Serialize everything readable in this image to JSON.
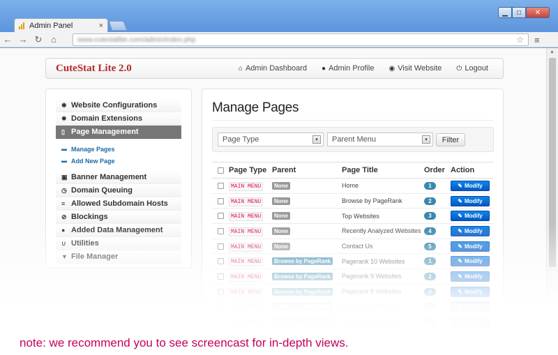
{
  "browser": {
    "tab_title": "Admin Panel",
    "tab_close": "×",
    "url": "www.cutestatlite.com/admin/index.php",
    "controls": {
      "minimize": "▁",
      "maximize": "□",
      "close": "✕"
    },
    "nav": {
      "back": "←",
      "forward": "→",
      "reload": "↻",
      "home": "⌂",
      "star": "☆",
      "menu": "≡"
    }
  },
  "navbar": {
    "brand": "CuteStat Lite 2.0",
    "links": [
      {
        "label": "Admin Dashboard",
        "icon": "home-icon",
        "glyph": "⌂"
      },
      {
        "label": "Admin Profile",
        "icon": "user-icon",
        "glyph": "●"
      },
      {
        "label": "Visit Website",
        "icon": "globe-icon",
        "glyph": "◉"
      },
      {
        "label": "Logout",
        "icon": "power-icon",
        "glyph": "⏻"
      }
    ]
  },
  "sidebar": {
    "items": [
      {
        "label": "Website Configurations",
        "icon": "gear-icon",
        "glyph": "✱"
      },
      {
        "label": "Domain Extensions",
        "icon": "asterisk-icon",
        "glyph": "✸"
      },
      {
        "label": "Page Management",
        "icon": "file-icon",
        "glyph": "▯"
      },
      {
        "label": "Banner Management",
        "icon": "picture-icon",
        "glyph": "▣"
      },
      {
        "label": "Domain Queuing",
        "icon": "time-icon",
        "glyph": "◷"
      },
      {
        "label": "Allowed Subdomain Hosts",
        "icon": "tasks-icon",
        "glyph": "≡"
      },
      {
        "label": "Blockings",
        "icon": "ban-icon",
        "glyph": "⊘"
      },
      {
        "label": "Added Data Management",
        "icon": "map-marker-icon",
        "glyph": "●"
      },
      {
        "label": "Utilities",
        "icon": "magnet-icon",
        "glyph": "∪"
      },
      {
        "label": "File Manager",
        "icon": "filter-icon",
        "glyph": "▼"
      }
    ],
    "sub_items": [
      {
        "label": "Manage Pages",
        "icon": "minus-icon",
        "glyph": "▬"
      },
      {
        "label": "Add New Page",
        "icon": "minus-icon",
        "glyph": "▬"
      }
    ]
  },
  "main": {
    "title": "Manage Pages",
    "filter": {
      "page_type": "Page Type",
      "parent_menu": "Parent Menu",
      "button": "Filter",
      "arrow": "▾"
    },
    "table": {
      "headers": [
        "Page Type",
        "Parent",
        "Page Title",
        "Order",
        "Action"
      ],
      "rows": [
        {
          "type": "MAIN MENU",
          "parent": "None",
          "title": "Home",
          "order": "1",
          "action": "Modify"
        },
        {
          "type": "MAIN MENU",
          "parent": "None",
          "title": "Browse by PageRank",
          "order": "2",
          "action": "Modify"
        },
        {
          "type": "MAIN MENU",
          "parent": "None",
          "title": "Top Websites",
          "order": "3",
          "action": "Modify"
        },
        {
          "type": "MAIN MENU",
          "parent": "None",
          "title": "Recently Analyzed Websites",
          "order": "4",
          "action": "Modify"
        },
        {
          "type": "MAIN MENU",
          "parent": "None",
          "title": "Contact Us",
          "order": "5",
          "action": "Modify"
        },
        {
          "type": "MAIN MENU",
          "parent": "Browse by PageRank",
          "title": "Pagerank 10 Websites",
          "order": "1",
          "action": "Modify"
        },
        {
          "type": "MAIN MENU",
          "parent": "Browse by PageRank",
          "title": "Pagerank 9 Websites",
          "order": "2",
          "action": "Modify"
        },
        {
          "type": "MAIN MENU",
          "parent": "Browse by PageRank",
          "title": "Pagerank 8 Websites",
          "order": "3",
          "action": "Modify"
        },
        {
          "type": "MAIN MENU",
          "parent": "Browse by PageRank",
          "title": "Pagerank 7 Websites",
          "order": "4",
          "action": "Modify"
        },
        {
          "type": "MAIN MENU",
          "parent": "Browse by PageRank",
          "title": "Pagerank 6 Websites",
          "order": "5",
          "action": "Modify"
        }
      ]
    }
  },
  "note": {
    "label": "note:",
    "text": " we recommend you to see screencast for in-depth views."
  },
  "colors": {
    "brand": "#b8262b",
    "primary_button": "#0a6fd8",
    "badge": "#3a87ad",
    "note": "#c4005a"
  }
}
